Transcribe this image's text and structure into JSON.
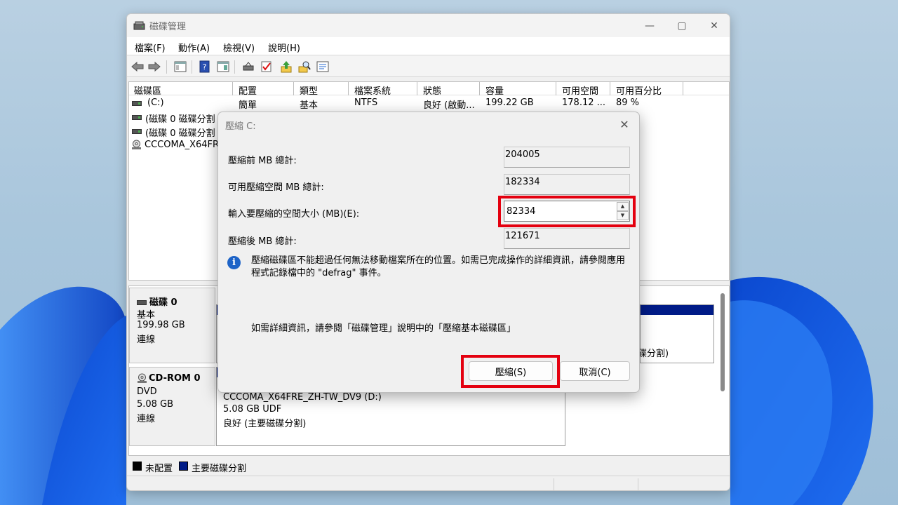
{
  "window": {
    "title": "磁碟管理",
    "minimize_glyph": "—",
    "maximize_glyph": "▢",
    "close_glyph": "✕"
  },
  "menu": [
    "檔案(F)",
    "動作(A)",
    "檢視(V)",
    "說明(H)"
  ],
  "toolbar": [
    "back-icon",
    "forward-icon",
    "console-tree-icon",
    "help-icon",
    "show-pane-icon",
    "connect-disk-icon",
    "check-icon",
    "up-arrow-icon",
    "search-icon",
    "properties-icon"
  ],
  "volumes": {
    "headers": [
      "磁碟區",
      "配置",
      "類型",
      "檔案系統",
      "狀態",
      "容量",
      "可用空間",
      "可用百分比"
    ],
    "rows": [
      {
        "name": "(C:)",
        "layout": "簡單",
        "type": "基本",
        "fs": "NTFS",
        "status": "良好 (啟動...",
        "capacity": "199.22 GB",
        "free": "178.12 ...",
        "pct": "89 %"
      },
      {
        "name": "(磁碟 0 磁碟分割"
      },
      {
        "name": "(磁碟 0 磁碟分割"
      },
      {
        "name": "CCCOMA_X64FR"
      }
    ]
  },
  "disks": [
    {
      "name": "磁碟 0",
      "kind": "基本",
      "size": "199.98 GB",
      "state": "連線",
      "right_partition_text": "碟分割)"
    },
    {
      "name": "CD-ROM 0",
      "kind": "DVD",
      "size": "5.08 GB",
      "state": "連線",
      "partition_lines": [
        "CCCOMA_X64FRE_ZH-TW_DV9 (D:)",
        "5.08 GB UDF",
        "良好 (主要磁碟分割)"
      ]
    }
  ],
  "legend": [
    {
      "label": "未配置",
      "color": "#000000"
    },
    {
      "label": "主要磁碟分割",
      "color": "#001b87"
    }
  ],
  "dialog": {
    "title": "壓縮 C:",
    "close_glyph": "✕",
    "total_before_label": "壓縮前 MB 總計:",
    "total_before_value": "204005",
    "available_label": "可用壓縮空間 MB 總計:",
    "available_value": "182334",
    "amount_label": "輸入要壓縮的空間大小 (MB)(E):",
    "amount_value": "82334",
    "total_after_label": "壓縮後 MB 總計:",
    "total_after_value": "121671",
    "info_text": "壓縮磁碟區不能超過任何無法移動檔案所在的位置。如需已完成操作的詳細資訊，請參閱應用程式記錄檔中的 \"defrag\" 事件。",
    "help_text": "如需詳細資訊，請參閱「磁碟管理」說明中的「壓縮基本磁碟區」",
    "shrink_button": "壓縮(S)",
    "cancel_button": "取消(C)",
    "highlight_color": "#e4000f",
    "info_icon_glyph": "i",
    "spin_up_glyph": "▲",
    "spin_down_glyph": "▼"
  }
}
